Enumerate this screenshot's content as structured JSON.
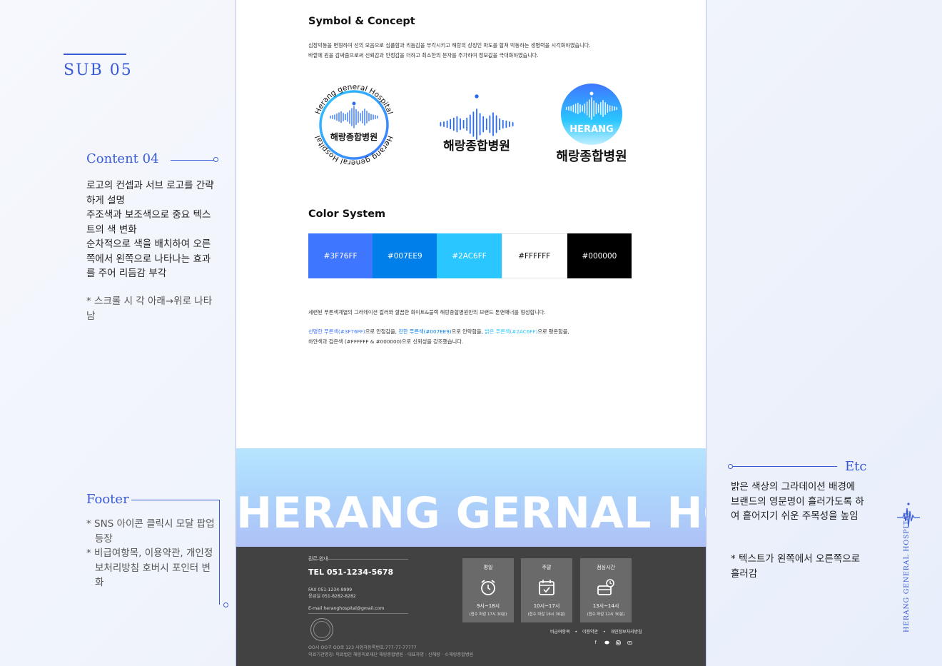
{
  "annotations": {
    "sub_title": "SUB 05",
    "content": {
      "title": "Content 04",
      "lines": [
        "로고의 컨셉과 서브 로고를 간략하게 설명",
        "주조색과 보조색으로 중요 텍스트의 색 변화",
        "순차적으로 색을 배치하여 오른쪽에서 왼쪽으로 나타나는 효과를 주어 리듬감 부각"
      ],
      "note": "* 스크롤 시 각 아래→위로 나타남"
    },
    "footer": {
      "title": "Footer",
      "items": [
        "* SNS 아이콘 클릭시 모달 팝업등장",
        "* 비급여항목, 이용약관, 개인정보처리방침 호버시 포인터 변화"
      ]
    },
    "etc": {
      "title": "Etc",
      "text": "밝은 색상의 그라데이션 배경에 브랜드의 영문명이 흘러가도록 하여 흩어지기 쉬운 주목성을 높임",
      "note": "* 텍스트가 왼쪽에서 오른쪽으로 흘러감"
    },
    "vertical_brand": "HERANG GENERAL HOSPITAL"
  },
  "page": {
    "symbol": {
      "title": "Symbol & Concept",
      "desc_line1": "심장박동을 변형하여 선의 모음으로 심플함과 리듬감을 부각시키고 해랑의 상징인 파도를 합쳐 박동하는 생명력을 시각화하였습니다.",
      "desc_line2": "바깥에 원을 감싸줌으로써 신뢰감과 안정감을 더하고 최소한의 문자를 추가하여 정보값을 극대화하였습니다."
    },
    "logos": {
      "ring_text_top": "Herang general Hospital",
      "ring_text_bottom": "Herang general Hospital",
      "kr_name": "해랑종합병원",
      "en_name": "HERANG"
    },
    "color_system": {
      "title": "Color System",
      "swatches": [
        {
          "label": "#3F76FF",
          "color": "#3F76FF"
        },
        {
          "label": "#007EE9",
          "color": "#007EE9"
        },
        {
          "label": "#2AC6FF",
          "color": "#2AC6FF"
        },
        {
          "label": "#FFFFFF",
          "color": "#FFFFFF"
        },
        {
          "label": "#000000",
          "color": "#000000"
        }
      ],
      "desc1": "세련된 푸른색계열의 그라데이션 컬러와 깔끔한 화이트&블랙 해랑종합병원만의 브랜드 톤앤매너를 형성합니다.",
      "desc2": {
        "p1": "선명한 푸른색(#3F76FF)",
        "t1": "으로 안정감을, ",
        "p2": "진한 푸른색(#007EE9)",
        "t2": "으로 안락함을, ",
        "p3": "밝은 푸른색(#2AC6FF)",
        "t3": "으로 평온함을,",
        "line2": "하얀색과 검은색 (#FFFFFF & #000000)으로 신뢰성을 강조했습니다."
      }
    },
    "banner_text": "HERANG GERNAL HOSPITAL",
    "footer": {
      "section_label": "진료 안내",
      "tel": "TEL 051-1234-5678",
      "fax": "FAX 051-1234-9999",
      "emergency": "응급실 051-8282-8282",
      "email": "E-mail heranghospital@gmail.com",
      "hours": [
        {
          "title": "평일",
          "time": "9시~18시",
          "sub": "(접수 마감 17시 30분)",
          "icon": "alarm-clock-icon"
        },
        {
          "title": "주말",
          "time": "10시~17시",
          "sub": "(접수 마감 16시 30분)",
          "icon": "calendar-check-icon"
        },
        {
          "title": "점심시간",
          "time": "13시~14시",
          "sub": "(접수 마감 12시 30분)",
          "icon": "lunch-clock-icon"
        }
      ],
      "links": [
        "비급여항목",
        "이용약관",
        "개인정보처리방침"
      ],
      "sns": [
        "facebook-icon",
        "chat-icon",
        "instagram-icon",
        "youtube-icon"
      ],
      "address": "OO시 OO구 OO로 123    사업자등록번호:777-77-77777",
      "legal": "의료기관명칭: 의료법인 해랑의료재단 해랑종합병원  ·  대표자명 : 신해랑  ·  ©해랑종합병원"
    }
  }
}
